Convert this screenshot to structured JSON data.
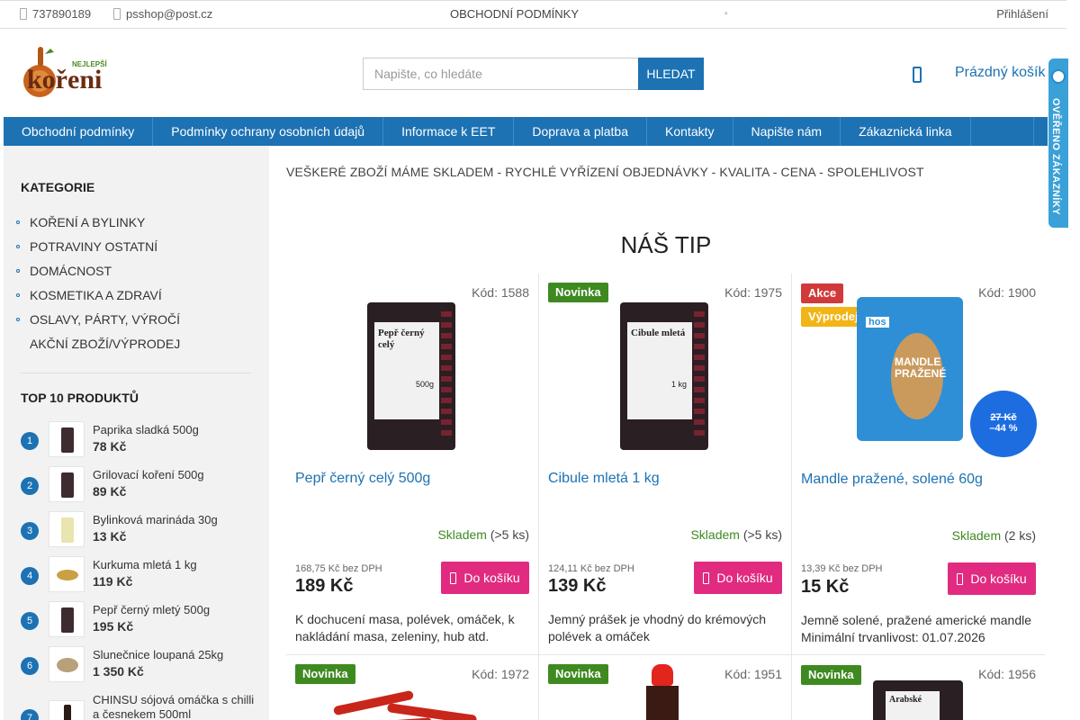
{
  "topbar": {
    "phone": "737890189",
    "email": "psshop@post.cz",
    "terms": "OBCHODNÍ PODMÍNKY",
    "login": "Přihlášení"
  },
  "search": {
    "placeholder": "Napište, co hledáte",
    "button": "HLEDAT"
  },
  "cart": {
    "label": "Prázdný košík"
  },
  "verified_badge": "OVĚŘENO ZÁKAZNÍKY",
  "nav": [
    "Obchodní podmínky",
    "Podmínky ochrany osobních údajů",
    "Informace k EET",
    "Doprava a platba",
    "Kontakty",
    "Napište nám",
    "Zákaznická linka"
  ],
  "sidebar": {
    "categories_title": "KATEGORIE",
    "categories": [
      "KOŘENÍ A BYLINKY",
      "POTRAVINY OSTATNÍ",
      "DOMÁCNOST",
      "KOSMETIKA A ZDRAVÍ",
      "OSLAVY, PÁRTY, VÝROČÍ",
      "AKČNÍ ZBOŽÍ/VÝPRODEJ"
    ],
    "top_title": "TOP 10 PRODUKTŮ",
    "top": [
      {
        "rank": "1",
        "name": "Paprika sladká 500g",
        "price": "78 Kč"
      },
      {
        "rank": "2",
        "name": "Grilovací koření 500g",
        "price": "89 Kč"
      },
      {
        "rank": "3",
        "name": "Bylinková marináda 30g",
        "price": "13 Kč"
      },
      {
        "rank": "4",
        "name": "Kurkuma mletá 1 kg",
        "price": "119 Kč"
      },
      {
        "rank": "5",
        "name": "Pepř černý mletý 500g",
        "price": "195 Kč"
      },
      {
        "rank": "6",
        "name": "Slunečnice loupaná 25kg",
        "price": "1 350 Kč"
      },
      {
        "rank": "7",
        "name": "CHINSU sójová omáčka s chilli a česnekem 500ml",
        "price": ""
      }
    ]
  },
  "banner": "VEŠKERÉ ZBOŽÍ MÁME SKLADEM - RYCHLÉ VYŘÍZENÍ OBJEDNÁVKY - KVALITA - CENA - SPOLEHLIVOST",
  "tip_title": "NÁŠ TIP",
  "products": [
    {
      "code": "Kód: 1588",
      "badges": [],
      "img_title": "Pepř černý celý",
      "img_weight": "500g",
      "name": "Pepř černý celý 500g",
      "stock": "Skladem",
      "stock_qty": "(>5 ks)",
      "price_no_vat": "168,75 Kč bez DPH",
      "price": "189 Kč",
      "buy": "Do košíku",
      "desc": "K dochucení masa, polévek, omáček, k nakládání masa, zeleniny, hub atd."
    },
    {
      "code": "Kód: 1975",
      "badges": [
        "Novinka"
      ],
      "img_title": "Cibule mletá",
      "img_weight": "1 kg",
      "name": "Cibule mletá 1 kg",
      "stock": "Skladem",
      "stock_qty": "(>5 ks)",
      "price_no_vat": "124,11 Kč bez DPH",
      "price": "139 Kč",
      "buy": "Do košíku",
      "desc": "Jemný prášek je vhodný do krémových polévek a omáček"
    },
    {
      "code": "Kód: 1900",
      "badges": [
        "Akce",
        "Výprodej"
      ],
      "img_brand": "hos",
      "img_title": "MANDLE PRAŽENÉ",
      "discount_old": "27 Kč",
      "discount_pct": "–44 %",
      "name": "Mandle pražené, solené 60g",
      "stock": "Skladem",
      "stock_qty": "(2 ks)",
      "price_no_vat": "13,39 Kč bez DPH",
      "price": "15 Kč",
      "buy": "Do košíku",
      "desc": "Jemně solené, pražené americké mandle  Minimální trvanlivost: 01.07.2026"
    }
  ],
  "products_row2": [
    {
      "code": "Kód: 1972",
      "badge": "Novinka"
    },
    {
      "code": "Kód: 1951",
      "badge": "Novinka"
    },
    {
      "code": "Kód: 1956",
      "badge": "Novinka",
      "img_title": "Arabské"
    }
  ],
  "colors": {
    "primary": "#1c72b3",
    "buy": "#e12b80",
    "new": "#3e8a21",
    "sale": "#d13a3a",
    "clearance": "#f2b517",
    "sidebar_bg": "#f2f2f2"
  }
}
